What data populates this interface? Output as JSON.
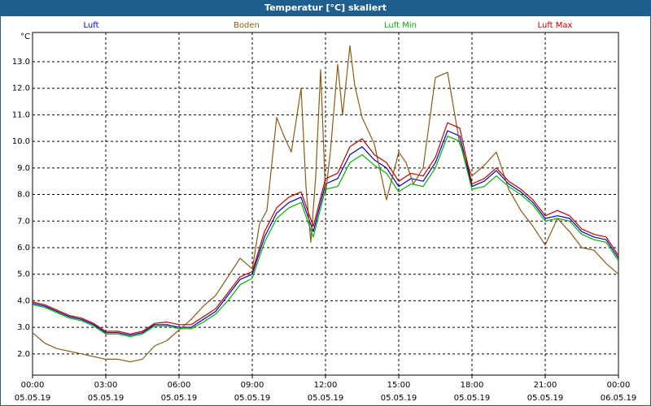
{
  "chart_data": {
    "type": "line",
    "title": "Temperatur [°C] skaliert",
    "ylabel": "°C",
    "ylim": [
      1.2,
      14.1
    ],
    "yticks": [
      "2.0",
      "3.0",
      "4.0",
      "5.0",
      "6.0",
      "7.0",
      "8.0",
      "9.0",
      "10.0",
      "11.0",
      "12.0",
      "13.0"
    ],
    "xlim": [
      0,
      24
    ],
    "xticks": [
      {
        "t": 0,
        "time": "00:00",
        "date": "05.05.19"
      },
      {
        "t": 3,
        "time": "03:00",
        "date": "05.05.19"
      },
      {
        "t": 6,
        "time": "06:00",
        "date": "05.05.19"
      },
      {
        "t": 9,
        "time": "09:00",
        "date": "05.05.19"
      },
      {
        "t": 12,
        "time": "12:00",
        "date": "05.05.19"
      },
      {
        "t": 15,
        "time": "15:00",
        "date": "05.05.19"
      },
      {
        "t": 18,
        "time": "18:00",
        "date": "05.05.19"
      },
      {
        "t": 21,
        "time": "21:00",
        "date": "05.05.19"
      },
      {
        "t": 24,
        "time": "00:00",
        "date": "06.05.19"
      }
    ],
    "grid": true,
    "legend_position": "top",
    "series": [
      {
        "name": "Luft",
        "color": "#0000c0",
        "x": [
          0,
          0.5,
          1,
          1.5,
          2,
          2.5,
          3,
          3.5,
          4,
          4.5,
          5,
          5.5,
          6,
          6.5,
          7,
          7.5,
          8,
          8.5,
          9,
          9.5,
          10,
          10.5,
          11,
          11.5,
          12,
          12.5,
          13,
          13.5,
          14,
          14.5,
          15,
          15.5,
          16,
          16.5,
          17,
          17.5,
          18,
          18.5,
          19,
          19.5,
          20,
          20.5,
          21,
          21.5,
          22,
          22.5,
          23,
          23.5,
          24
        ],
        "values": [
          3.9,
          3.8,
          3.6,
          3.4,
          3.3,
          3.1,
          2.8,
          2.8,
          2.7,
          2.8,
          3.1,
          3.1,
          3.0,
          3.0,
          3.3,
          3.6,
          4.2,
          4.8,
          5.0,
          6.4,
          7.3,
          7.7,
          7.9,
          6.6,
          8.4,
          8.6,
          9.5,
          9.8,
          9.3,
          9.0,
          8.3,
          8.6,
          8.5,
          9.2,
          10.4,
          10.2,
          8.3,
          8.5,
          8.9,
          8.4,
          8.1,
          7.7,
          7.1,
          7.2,
          7.1,
          6.6,
          6.4,
          6.3,
          5.6
        ]
      },
      {
        "name": "Boden",
        "color": "#8b5a14",
        "x": [
          0,
          0.5,
          1,
          1.5,
          2,
          2.5,
          3,
          3.5,
          4,
          4.5,
          5,
          5.5,
          6,
          6.5,
          7,
          7.5,
          8,
          8.5,
          9,
          9.3,
          9.6,
          10,
          10.3,
          10.6,
          11,
          11.2,
          11.4,
          11.6,
          11.8,
          12,
          12.2,
          12.5,
          12.7,
          13,
          13.2,
          13.5,
          13.7,
          14,
          14.5,
          15,
          15.3,
          15.6,
          16,
          16.5,
          17,
          17.5,
          18,
          18.5,
          19,
          19.5,
          20,
          20.5,
          21,
          21.5,
          22,
          22.5,
          23,
          23.5,
          24
        ],
        "values": [
          2.8,
          2.4,
          2.2,
          2.1,
          2.0,
          1.9,
          1.8,
          1.8,
          1.7,
          1.8,
          2.3,
          2.5,
          2.9,
          3.3,
          3.8,
          4.2,
          4.9,
          5.6,
          5.2,
          6.9,
          7.4,
          10.9,
          10.2,
          9.6,
          12.0,
          8.3,
          6.2,
          8.7,
          12.7,
          8.0,
          9.6,
          12.9,
          11.0,
          13.6,
          12.1,
          10.9,
          10.5,
          9.9,
          7.8,
          9.6,
          9.2,
          8.4,
          9.0,
          12.4,
          12.6,
          9.9,
          8.7,
          9.1,
          9.6,
          8.2,
          7.4,
          6.8,
          6.1,
          7.1,
          6.6,
          6.0,
          5.9,
          5.4,
          5.0
        ]
      },
      {
        "name": "Luft Min",
        "color": "#00b400",
        "x": [
          0,
          0.5,
          1,
          1.5,
          2,
          2.5,
          3,
          3.5,
          4,
          4.5,
          5,
          5.5,
          6,
          6.5,
          7,
          7.5,
          8,
          8.5,
          9,
          9.5,
          10,
          10.5,
          11,
          11.5,
          12,
          12.5,
          13,
          13.5,
          14,
          14.5,
          15,
          15.5,
          16,
          16.5,
          17,
          17.5,
          18,
          18.5,
          19,
          19.5,
          20,
          20.5,
          21,
          21.5,
          22,
          22.5,
          23,
          23.5,
          24
        ],
        "values": [
          3.85,
          3.75,
          3.55,
          3.35,
          3.25,
          3.05,
          2.75,
          2.75,
          2.65,
          2.75,
          3.05,
          3.05,
          2.95,
          2.95,
          3.2,
          3.5,
          4.0,
          4.6,
          4.85,
          6.2,
          7.1,
          7.5,
          7.7,
          6.4,
          8.2,
          8.3,
          9.2,
          9.5,
          9.1,
          8.8,
          8.1,
          8.4,
          8.3,
          9.0,
          10.2,
          10.0,
          8.2,
          8.3,
          8.7,
          8.3,
          8.0,
          7.6,
          7.0,
          7.1,
          7.0,
          6.5,
          6.3,
          6.2,
          5.5
        ]
      },
      {
        "name": "Luft Max",
        "color": "#c00000",
        "x": [
          0,
          0.5,
          1,
          1.5,
          2,
          2.5,
          3,
          3.5,
          4,
          4.5,
          5,
          5.5,
          6,
          6.5,
          7,
          7.5,
          8,
          8.5,
          9,
          9.5,
          10,
          10.5,
          11,
          11.5,
          12,
          12.5,
          13,
          13.5,
          14,
          14.5,
          15,
          15.5,
          16,
          16.5,
          17,
          17.5,
          18,
          18.5,
          19,
          19.5,
          20,
          20.5,
          21,
          21.5,
          22,
          22.5,
          23,
          23.5,
          24
        ],
        "values": [
          3.95,
          3.85,
          3.65,
          3.45,
          3.35,
          3.15,
          2.85,
          2.85,
          2.75,
          2.85,
          3.15,
          3.2,
          3.1,
          3.1,
          3.4,
          3.7,
          4.3,
          4.9,
          5.1,
          6.6,
          7.5,
          7.9,
          8.1,
          6.8,
          8.6,
          8.8,
          9.8,
          10.1,
          9.5,
          9.2,
          8.5,
          8.8,
          8.7,
          9.4,
          10.7,
          10.5,
          8.4,
          8.6,
          9.0,
          8.5,
          8.2,
          7.8,
          7.2,
          7.4,
          7.2,
          6.7,
          6.5,
          6.4,
          5.7
        ]
      }
    ]
  }
}
